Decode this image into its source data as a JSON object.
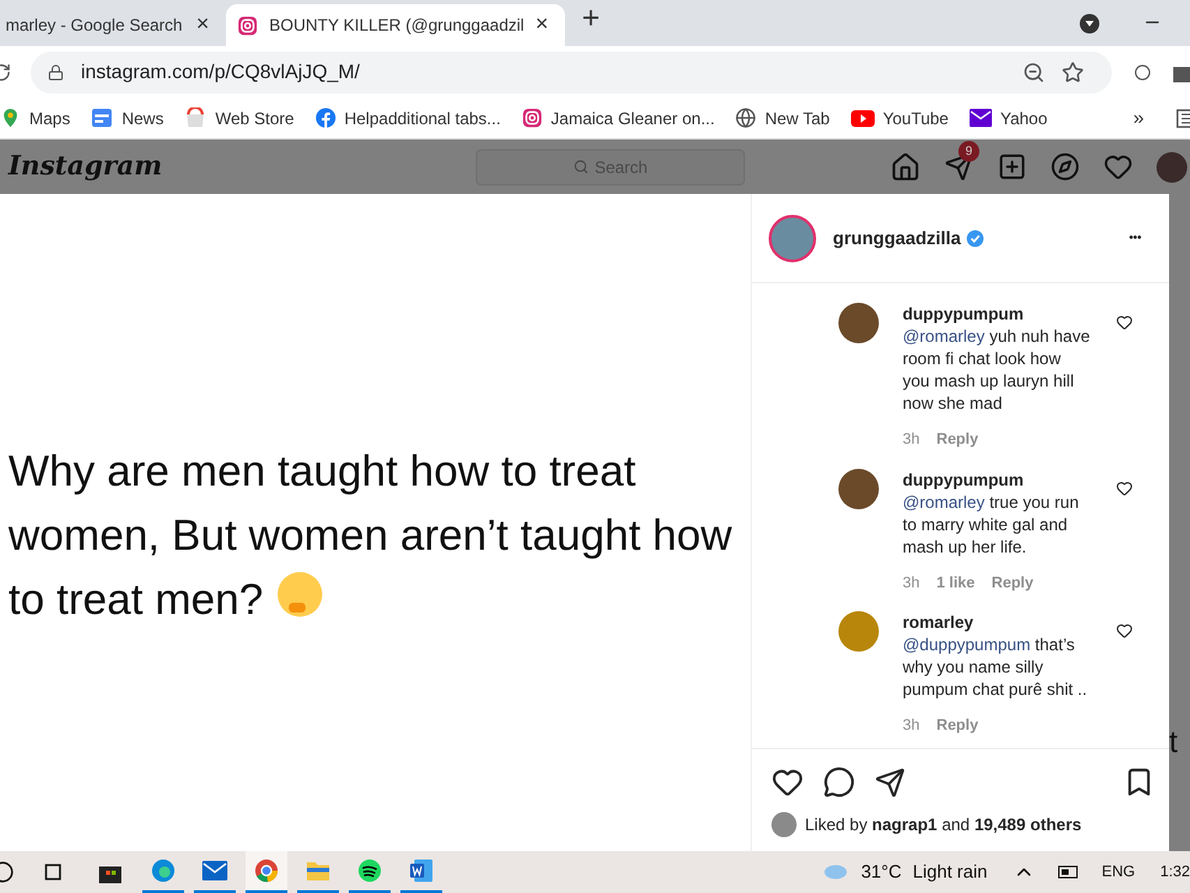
{
  "browser_tabs": [
    {
      "title": "marley - Google Search",
      "selected": false,
      "close": "×"
    },
    {
      "title": "BOUNTY KILLER (@grunggaadzil",
      "selected": true,
      "close": "×"
    }
  ],
  "new_tab": "+",
  "address": "instagram.com/p/CQ8vlAjJQ_M/",
  "bookmarks": [
    {
      "label": "Maps"
    },
    {
      "label": "News"
    },
    {
      "label": "Web Store"
    },
    {
      "label": "Helpadditional tabs..."
    },
    {
      "label": "Jamaica Gleaner on..."
    },
    {
      "label": "New Tab"
    },
    {
      "label": "YouTube"
    },
    {
      "label": "Yahoo"
    }
  ],
  "bookmarks_more": "»",
  "ig_header": {
    "logo": "Instagram",
    "search_placeholder": "Search",
    "notification_count": "9"
  },
  "post": {
    "text": "Why are men taught how to treat women, But women aren’t taught how to treat men?"
  },
  "panel": {
    "username": "grunggaadzilla",
    "verified": true,
    "menu": "•••",
    "comments": [
      {
        "user": "duppypumpum",
        "mention": "@romarley",
        "text": "yuh nuh have room fi chat look how you mash up lauryn hill now she mad",
        "time": "3h",
        "reply": "Reply",
        "color": "#6b4a2a"
      },
      {
        "user": "duppypumpum",
        "mention": "@romarley",
        "text": "true you run to marry white gal and mash up her life.",
        "time": "3h",
        "likes": "1 like",
        "reply": "Reply",
        "color": "#6b4a2a"
      },
      {
        "user": "romarley",
        "mention": "@duppypumpum",
        "text": "that’s why you name silly pumpum chat purê shit ..",
        "time": "3h",
        "reply": "Reply",
        "color": "#b8860b"
      }
    ],
    "liked_prefix": "Liked by",
    "liked_user": "nagrap1",
    "liked_and": "and",
    "liked_count": "19,489 others"
  },
  "background_fragment": "t",
  "taskbar": {
    "weather": "31°C",
    "weather_text": "Light rain",
    "lang": "ENG",
    "time": "1:32",
    "apps": [
      {
        "active": false
      },
      {
        "active": false
      },
      {
        "active": true
      },
      {
        "active": false
      },
      {
        "active": false
      },
      {
        "active": false
      }
    ]
  }
}
